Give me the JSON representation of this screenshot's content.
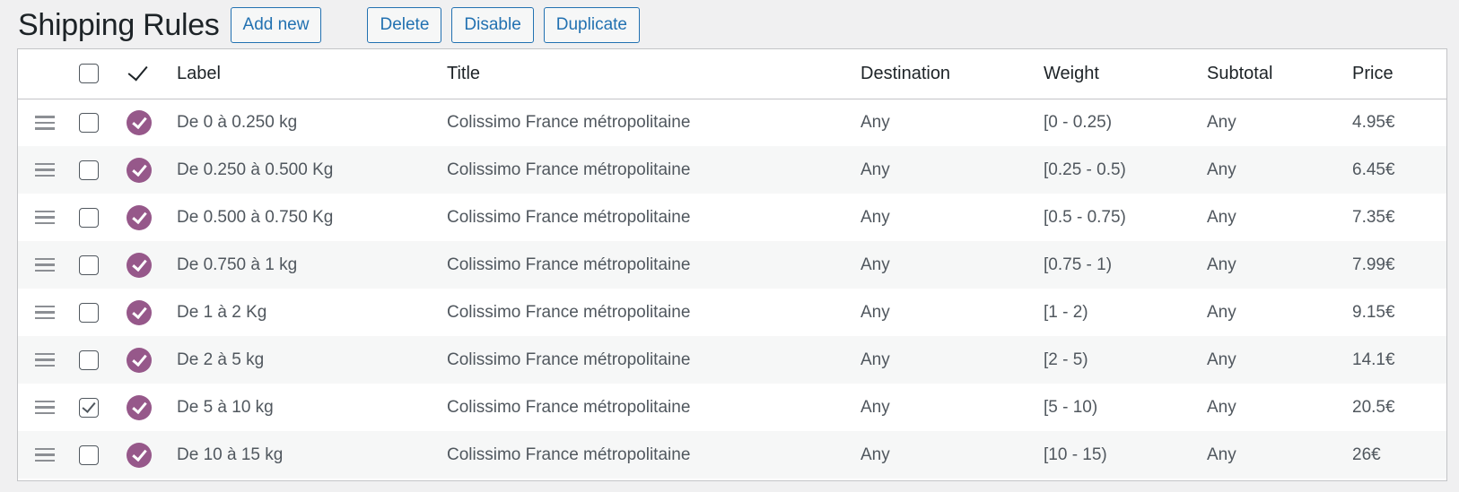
{
  "page": {
    "title": "Shipping Rules",
    "buttons": {
      "add_new": "Add new",
      "delete": "Delete",
      "disable": "Disable",
      "duplicate": "Duplicate"
    }
  },
  "table": {
    "columns": {
      "label": "Label",
      "title": "Title",
      "destination": "Destination",
      "weight": "Weight",
      "subtotal": "Subtotal",
      "price": "Price"
    },
    "rows": [
      {
        "label": "De 0 à 0.250 kg",
        "title": "Colissimo France métropolitaine",
        "destination": "Any",
        "weight": "[0 - 0.25)",
        "subtotal": "Any",
        "price": "4.95€",
        "selected": false,
        "enabled": true
      },
      {
        "label": "De 0.250 à 0.500 Kg",
        "title": "Colissimo France métropolitaine",
        "destination": "Any",
        "weight": "[0.25 - 0.5)",
        "subtotal": "Any",
        "price": "6.45€",
        "selected": false,
        "enabled": true
      },
      {
        "label": "De 0.500 à 0.750 Kg",
        "title": "Colissimo France métropolitaine",
        "destination": "Any",
        "weight": "[0.5 - 0.75)",
        "subtotal": "Any",
        "price": "7.35€",
        "selected": false,
        "enabled": true
      },
      {
        "label": "De 0.750 à 1 kg",
        "title": "Colissimo France métropolitaine",
        "destination": "Any",
        "weight": "[0.75 - 1)",
        "subtotal": "Any",
        "price": "7.99€",
        "selected": false,
        "enabled": true
      },
      {
        "label": "De 1 à 2 Kg",
        "title": "Colissimo France métropolitaine",
        "destination": "Any",
        "weight": "[1 - 2)",
        "subtotal": "Any",
        "price": "9.15€",
        "selected": false,
        "enabled": true
      },
      {
        "label": "De 2 à 5 kg",
        "title": "Colissimo France métropolitaine",
        "destination": "Any",
        "weight": "[2 - 5)",
        "subtotal": "Any",
        "price": "14.1€",
        "selected": false,
        "enabled": true
      },
      {
        "label": "De 5 à 10 kg",
        "title": "Colissimo France métropolitaine",
        "destination": "Any",
        "weight": "[5 - 10)",
        "subtotal": "Any",
        "price": "20.5€",
        "selected": true,
        "enabled": true
      },
      {
        "label": "De 10 à 15 kg",
        "title": "Colissimo France métropolitaine",
        "destination": "Any",
        "weight": "[10 - 15)",
        "subtotal": "Any",
        "price": "26€",
        "selected": false,
        "enabled": true
      }
    ]
  },
  "icons": {
    "drag": "drag-handle-icon",
    "enabled": "enabled-check-icon",
    "header_enabled": "checkmark-icon"
  },
  "colors": {
    "accent": "#2271b1",
    "enabled": "#96588a"
  }
}
